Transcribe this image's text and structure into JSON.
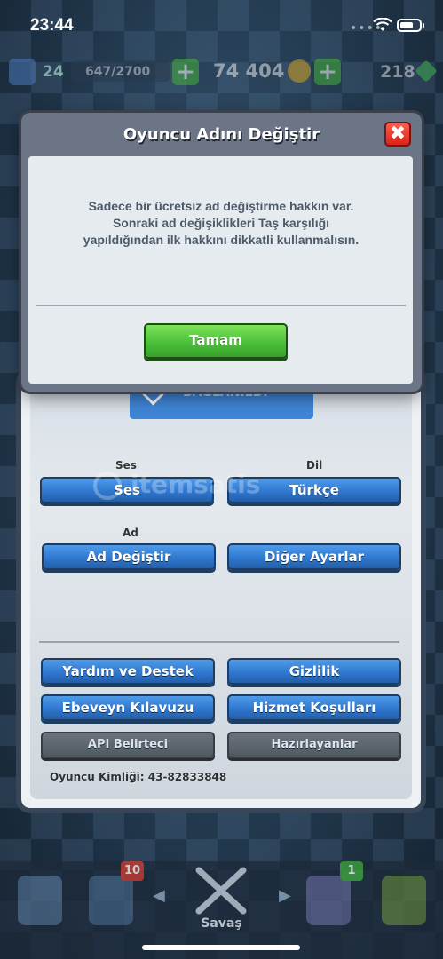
{
  "status_bar": {
    "time": "23:44"
  },
  "top_bar": {
    "level": "24",
    "xp": "647/2700",
    "gold": "74 404",
    "gems": "218",
    "plus": "+"
  },
  "modal": {
    "title": "Oyuncu Adını Değiştir",
    "close": "✖",
    "message": "Sadece bir ücretsiz ad değiştirme hakkın var. Sonraki ad değişiklikleri Taş karşılığı yapıldığından ilk hakkını dikkatli kullanmalısın.",
    "ok_label": "Tamam"
  },
  "settings": {
    "linked_label": "BAĞLANILDI",
    "sound_section": "Ses",
    "language_section": "Dil",
    "sound_button": "Ses",
    "language_button": "Türkçe",
    "name_section": "Ad",
    "change_name_button": "Ad Değiştir",
    "other_settings_button": "Diğer Ayarlar",
    "help_button": "Yardım ve Destek",
    "privacy_button": "Gizlilik",
    "parent_guide_button": "Ebeveyn Kılavuzu",
    "terms_button": "Hizmet Koşulları",
    "api_button": "API Belirteci",
    "credits_button": "Hazırlayanlar",
    "player_id": "Oyuncu Kimliği: 43-82833848"
  },
  "watermark": "itemsatis",
  "bottom_nav": {
    "battle_label": "Savaş",
    "cards_badge": "10",
    "clan_badge": "1",
    "left_arrow": "◀",
    "right_arrow": "▶"
  }
}
